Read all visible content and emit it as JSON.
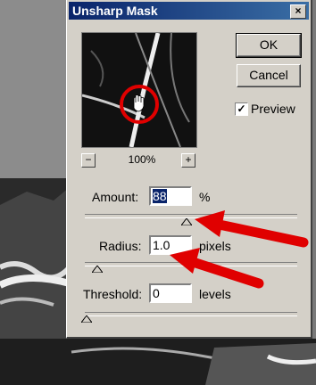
{
  "dialog": {
    "title": "Unsharp Mask",
    "close_glyph": "×",
    "ok_label": "OK",
    "cancel_label": "Cancel",
    "preview_label": "Preview",
    "preview_checked": true,
    "checkmark": "✓",
    "zoom": "100%",
    "zoom_out": "−",
    "zoom_in": "+"
  },
  "fields": {
    "amount": {
      "label": "Amount:",
      "value": "88",
      "unit": "%",
      "slider_fraction": 0.48
    },
    "radius": {
      "label": "Radius:",
      "value": "1.0",
      "unit": "pixels",
      "slider_fraction": 0.05
    },
    "threshold": {
      "label": "Threshold:",
      "value": "0",
      "unit": "levels",
      "slider_fraction": 0.0
    }
  },
  "colors": {
    "titlebar": "#0a246a",
    "dialog_bg": "#d4d0c8",
    "annotation_red": "#e00000"
  }
}
